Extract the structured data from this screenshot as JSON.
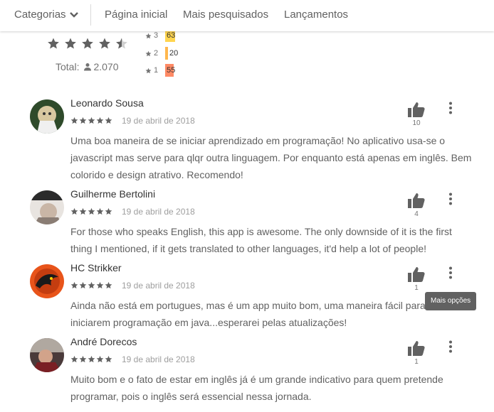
{
  "nav": {
    "categories": "Categorias",
    "home": "Página inicial",
    "top": "Mais pesquisados",
    "new": "Lançamentos"
  },
  "summary": {
    "total_label": "Total:",
    "total_value": "2.070",
    "histogram": [
      {
        "star": "3",
        "count": "63",
        "color": "#ffd54f"
      },
      {
        "star": "2",
        "count": "20",
        "color": "#ffb74d"
      },
      {
        "star": "1",
        "count": "55",
        "color": "#ff8a65"
      }
    ]
  },
  "reviews": [
    {
      "name": "Leonardo Sousa",
      "date": "19 de abril de 2018",
      "rating": 5,
      "helpful": "10",
      "text": "Uma boa maneira de se iniciar aprendizado em programação! No aplicativo usa-se o javascript mas serve para qlqr outra linguagem. Por enquanto está apenas em inglês. Bem colorido e design atrativo. Recomendo!"
    },
    {
      "name": "Guilherme Bertolini",
      "date": "19 de abril de 2018",
      "rating": 5,
      "helpful": "4",
      "text": "For those who speaks English, this app is awesome. The only downside of it is the first thing I mentioned, if it gets translated to other languages, it'd help a lot of people!"
    },
    {
      "name": "HC Strikker",
      "date": "19 de abril de 2018",
      "rating": 5,
      "helpful": "1",
      "text": "Ainda não está em portugues, mas é um app muito bom, uma maneira fácil para a iniciarem programação em java...esperarei pelas atualizações!"
    },
    {
      "name": "André Dorecos",
      "date": "19 de abril de 2018",
      "rating": 5,
      "helpful": "1",
      "text": "Muito bom e o fato de estar em inglês já é um grande indicativo para quem pretende programar, pois o inglês será essencial nessa jornada."
    }
  ],
  "tooltip": "Mais opções"
}
